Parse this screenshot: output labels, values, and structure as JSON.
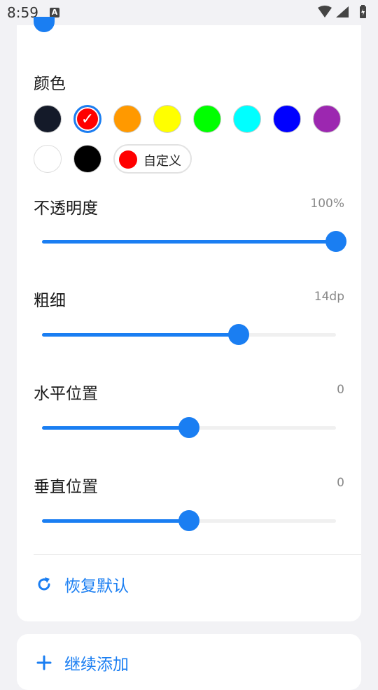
{
  "status_bar": {
    "time": "8:59",
    "notification_badge": "A"
  },
  "colors": {
    "title": "颜色",
    "swatches": [
      {
        "hex": "#141a29",
        "selected": false
      },
      {
        "hex": "#ff0000",
        "selected": true
      },
      {
        "hex": "#ff9900",
        "selected": false
      },
      {
        "hex": "#ffff00",
        "selected": false
      },
      {
        "hex": "#00ff00",
        "selected": false
      },
      {
        "hex": "#00ffff",
        "selected": false
      },
      {
        "hex": "#0000ff",
        "selected": false
      },
      {
        "hex": "#9c27b0",
        "selected": false
      },
      {
        "hex": "#ffffff",
        "selected": false
      },
      {
        "hex": "#000000",
        "selected": false
      }
    ],
    "check_glyph": "✓",
    "custom_label": "自定义",
    "custom_color": "#ff0000"
  },
  "opacity": {
    "title": "不透明度",
    "value_text": "100%",
    "fraction": 1.0
  },
  "thickness": {
    "title": "粗细",
    "value_text": "14dp",
    "fraction": 0.67
  },
  "horizontal": {
    "title": "水平位置",
    "value_text": "0",
    "fraction": 0.5
  },
  "vertical": {
    "title": "垂直位置",
    "value_text": "0",
    "fraction": 0.5
  },
  "actions": {
    "reset_label": "恢复默认",
    "continue_label": "继续添加"
  },
  "accent_color": "#1a7ef2"
}
